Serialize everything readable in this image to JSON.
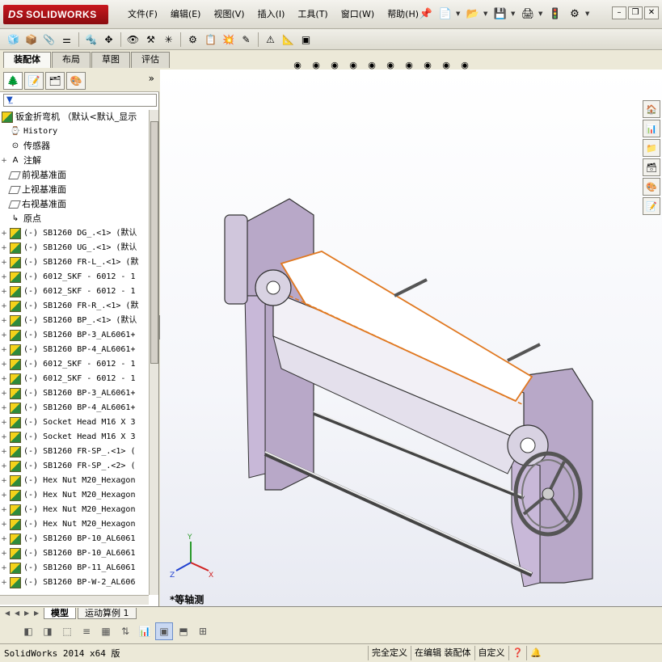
{
  "app": {
    "brand": "SOLIDWORKS",
    "brand_prefix": "DS"
  },
  "menu": {
    "items": [
      "文件(F)",
      "编辑(E)",
      "视图(V)",
      "插入(I)",
      "工具(T)",
      "窗口(W)",
      "帮助(H)"
    ]
  },
  "command_manager": {
    "tabs": [
      "装配体",
      "布局",
      "草图",
      "评估"
    ],
    "active": "装配体"
  },
  "feature_manager": {
    "root": "钣金折弯机 （默认<默认_显示",
    "items": [
      {
        "label": "History",
        "icon": "history-icon",
        "expand": "",
        "mono": true
      },
      {
        "label": "传感器",
        "icon": "sensor-icon",
        "expand": "",
        "mono": false
      },
      {
        "label": "注解",
        "icon": "annotation-icon",
        "expand": "+",
        "mono": false
      },
      {
        "label": "前视基准面",
        "icon": "plane-icon",
        "expand": "",
        "mono": false
      },
      {
        "label": "上视基准面",
        "icon": "plane-icon",
        "expand": "",
        "mono": false
      },
      {
        "label": "右视基准面",
        "icon": "plane-icon",
        "expand": "",
        "mono": false
      },
      {
        "label": "原点",
        "icon": "origin-icon",
        "expand": "",
        "mono": false
      },
      {
        "label": "(-) SB1260 DG_.<1> (默认",
        "icon": "part-icon",
        "expand": "+",
        "mono": true
      },
      {
        "label": "(-) SB1260 UG_.<1> (默认",
        "icon": "part-icon",
        "expand": "+",
        "mono": true
      },
      {
        "label": "(-) SB1260 FR-L_.<1> (默",
        "icon": "part-icon",
        "expand": "+",
        "mono": true
      },
      {
        "label": "(-) 6012_SKF - 6012 - 1",
        "icon": "part-icon",
        "expand": "+",
        "mono": true
      },
      {
        "label": "(-) 6012_SKF - 6012 - 1",
        "icon": "part-icon",
        "expand": "+",
        "mono": true
      },
      {
        "label": "(-) SB1260 FR-R_.<1> (默",
        "icon": "part-icon",
        "expand": "+",
        "mono": true
      },
      {
        "label": "(-) SB1260 BP_.<1> (默认",
        "icon": "part-icon",
        "expand": "+",
        "mono": true
      },
      {
        "label": "(-) SB1260 BP-3_AL6061+",
        "icon": "part-icon",
        "expand": "+",
        "mono": true
      },
      {
        "label": "(-) SB1260 BP-4_AL6061+",
        "icon": "part-icon",
        "expand": "+",
        "mono": true
      },
      {
        "label": "(-) 6012_SKF - 6012 - 1",
        "icon": "part-icon",
        "expand": "+",
        "mono": true
      },
      {
        "label": "(-) 6012_SKF - 6012 - 1",
        "icon": "part-icon",
        "expand": "+",
        "mono": true
      },
      {
        "label": "(-) SB1260 BP-3_AL6061+",
        "icon": "part-icon",
        "expand": "+",
        "mono": true
      },
      {
        "label": "(-) SB1260 BP-4_AL6061+",
        "icon": "part-icon",
        "expand": "+",
        "mono": true
      },
      {
        "label": "(-) Socket Head M16 X 3",
        "icon": "part-icon",
        "expand": "+",
        "mono": true
      },
      {
        "label": "(-) Socket Head M16 X 3",
        "icon": "part-icon",
        "expand": "+",
        "mono": true
      },
      {
        "label": "(-) SB1260 FR-SP_.<1> (",
        "icon": "part-icon",
        "expand": "+",
        "mono": true
      },
      {
        "label": "(-) SB1260 FR-SP_.<2> (",
        "icon": "part-icon",
        "expand": "+",
        "mono": true
      },
      {
        "label": "(-) Hex Nut M20_Hexagon",
        "icon": "part-icon",
        "expand": "+",
        "mono": true
      },
      {
        "label": "(-) Hex Nut M20_Hexagon",
        "icon": "part-icon",
        "expand": "+",
        "mono": true
      },
      {
        "label": "(-) Hex Nut M20_Hexagon",
        "icon": "part-icon",
        "expand": "+",
        "mono": true
      },
      {
        "label": "(-) Hex Nut M20_Hexagon",
        "icon": "part-icon",
        "expand": "+",
        "mono": true
      },
      {
        "label": "(-) SB1260 BP-10_AL6061",
        "icon": "part-icon",
        "expand": "+",
        "mono": true
      },
      {
        "label": "(-) SB1260 BP-10_AL6061",
        "icon": "part-icon",
        "expand": "+",
        "mono": true
      },
      {
        "label": "(-) SB1260 BP-11_AL6061",
        "icon": "part-icon",
        "expand": "+",
        "mono": true
      },
      {
        "label": "(-) SB1260 BP-W-2_AL606",
        "icon": "part-icon",
        "expand": "+",
        "mono": true
      }
    ]
  },
  "bottom_tabs": {
    "tabs": [
      "模型",
      "运动算例 1"
    ],
    "active": "模型"
  },
  "graphics": {
    "view_name": "*等轴测",
    "triad": {
      "x": "X",
      "y": "Y",
      "z": "Z"
    }
  },
  "status": {
    "text": "SolidWorks 2014 x64 版",
    "cells": [
      "完全定义",
      "在编辑 装配体",
      "自定义"
    ]
  },
  "colors": {
    "frame": "#b8a8c8",
    "roller": "#e8e4ee",
    "selection": "#e07820",
    "brand": "#b01218"
  }
}
